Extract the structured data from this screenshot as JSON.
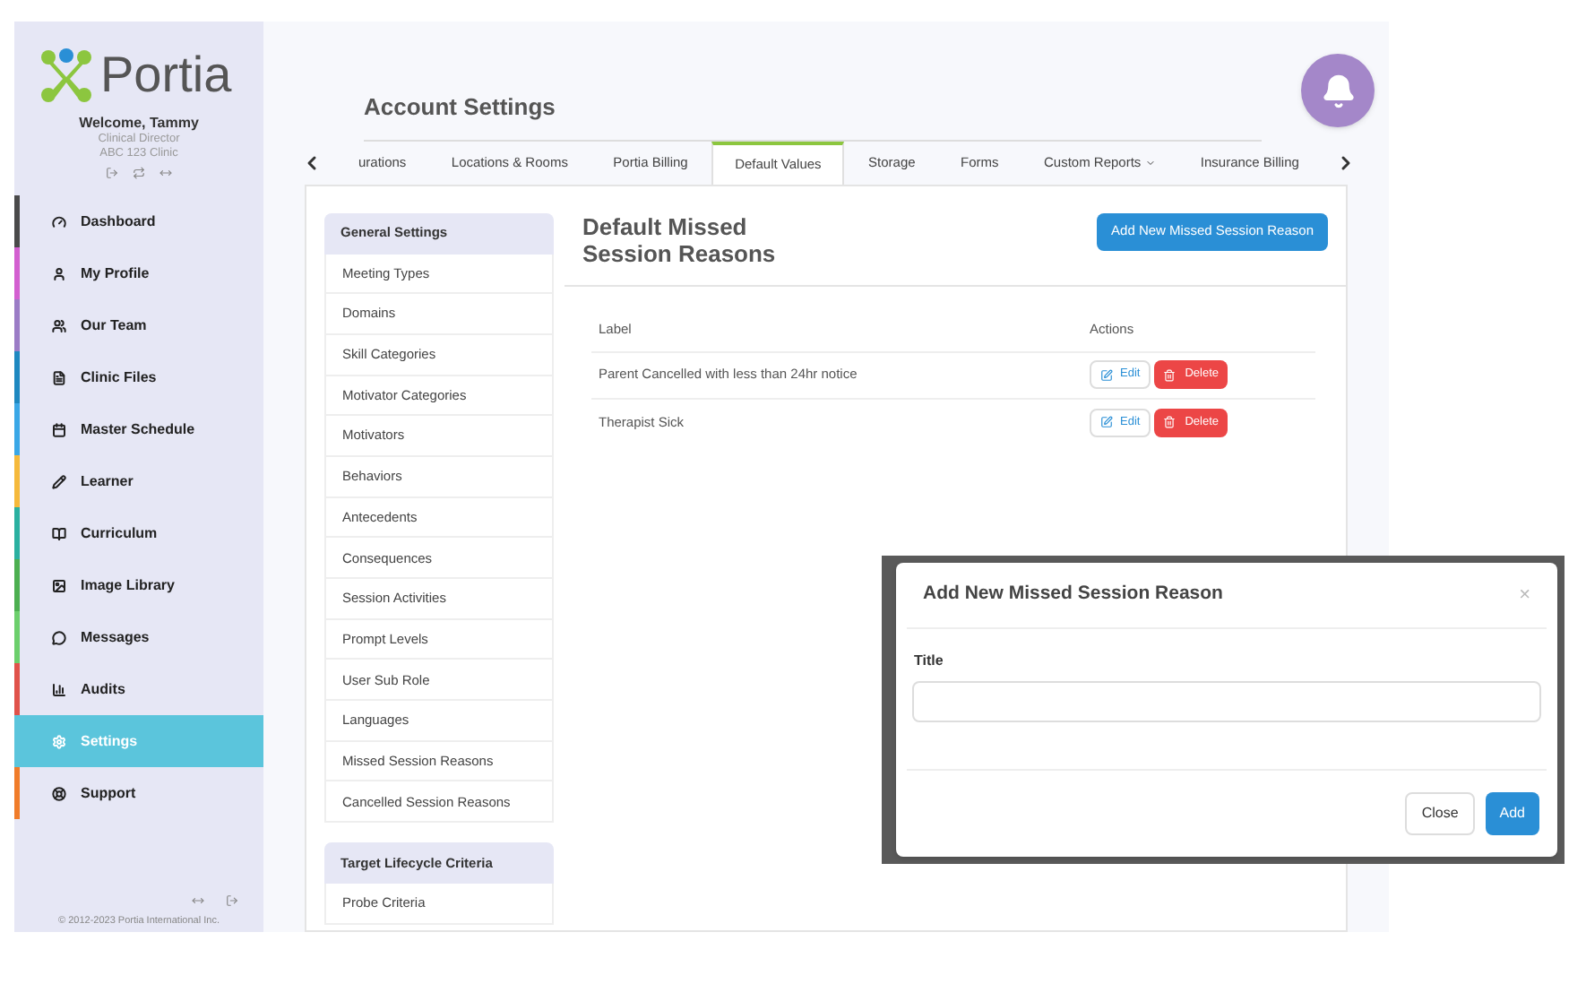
{
  "sidebar": {
    "brand": "Portia",
    "welcome": "Welcome, Tammy",
    "role": "Clinical Director",
    "clinic": "ABC 123 Clinic",
    "items": [
      {
        "label": "Dashboard",
        "color": "#4a4a4a",
        "selected": false
      },
      {
        "label": "My Profile",
        "color": "#d35fd0",
        "selected": false
      },
      {
        "label": "Our Team",
        "color": "#9b7cc6",
        "selected": false
      },
      {
        "label": "Clinic Files",
        "color": "#1e88c0",
        "selected": false
      },
      {
        "label": "Master Schedule",
        "color": "#3aa7e6",
        "selected": false
      },
      {
        "label": "Learner",
        "color": "#f5b93b",
        "selected": false
      },
      {
        "label": "Curriculum",
        "color": "#2ab0a0",
        "selected": false
      },
      {
        "label": "Image Library",
        "color": "#4caf50",
        "selected": false
      },
      {
        "label": "Messages",
        "color": "#6ccf6c",
        "selected": false
      },
      {
        "label": "Audits",
        "color": "#e0524a",
        "selected": false
      },
      {
        "label": "Settings",
        "color": "#5bc5dc",
        "selected": true
      },
      {
        "label": "Support",
        "color": "#f07c2a",
        "selected": false
      }
    ],
    "copyright": "© 2012-2023 Portia International Inc."
  },
  "page": {
    "title": "Account Settings"
  },
  "tabs": [
    {
      "label": "urations",
      "selected": false,
      "menu": false
    },
    {
      "label": "Locations & Rooms",
      "selected": false,
      "menu": false
    },
    {
      "label": "Portia Billing",
      "selected": false,
      "menu": false
    },
    {
      "label": "Default Values",
      "selected": true,
      "menu": false
    },
    {
      "label": "Storage",
      "selected": false,
      "menu": false
    },
    {
      "label": "Forms",
      "selected": false,
      "menu": false
    },
    {
      "label": "Custom Reports",
      "selected": false,
      "menu": true
    },
    {
      "label": "Insurance Billing",
      "selected": false,
      "menu": false
    }
  ],
  "settings_menu": [
    {
      "heading": "General Settings",
      "items": [
        "Meeting Types",
        "Domains",
        "Skill Categories",
        "Motivator Categories",
        "Motivators",
        "Behaviors",
        "Antecedents",
        "Consequences",
        "Session Activities",
        "Prompt Levels",
        "User Sub Role",
        "Languages",
        "Missed Session Reasons",
        "Cancelled Session Reasons"
      ]
    },
    {
      "heading": "Target Lifecycle Criteria",
      "items": [
        "Probe Criteria"
      ]
    }
  ],
  "content": {
    "title": "Default Missed Session Reasons",
    "add_button": "Add New Missed Session Reason",
    "table": {
      "columns": [
        "Label",
        "Actions"
      ],
      "rows": [
        {
          "label": "Parent Cancelled with less than 24hr notice",
          "edit": "Edit",
          "delete": "Delete"
        },
        {
          "label": "Therapist Sick",
          "edit": "Edit",
          "delete": "Delete"
        }
      ]
    }
  },
  "modal": {
    "title": "Add New Missed Session Reason",
    "close": "×",
    "field_label": "Title",
    "buttons": [
      {
        "label": "Close",
        "kind": "default"
      },
      {
        "label": "Add",
        "kind": "primary"
      }
    ]
  }
}
